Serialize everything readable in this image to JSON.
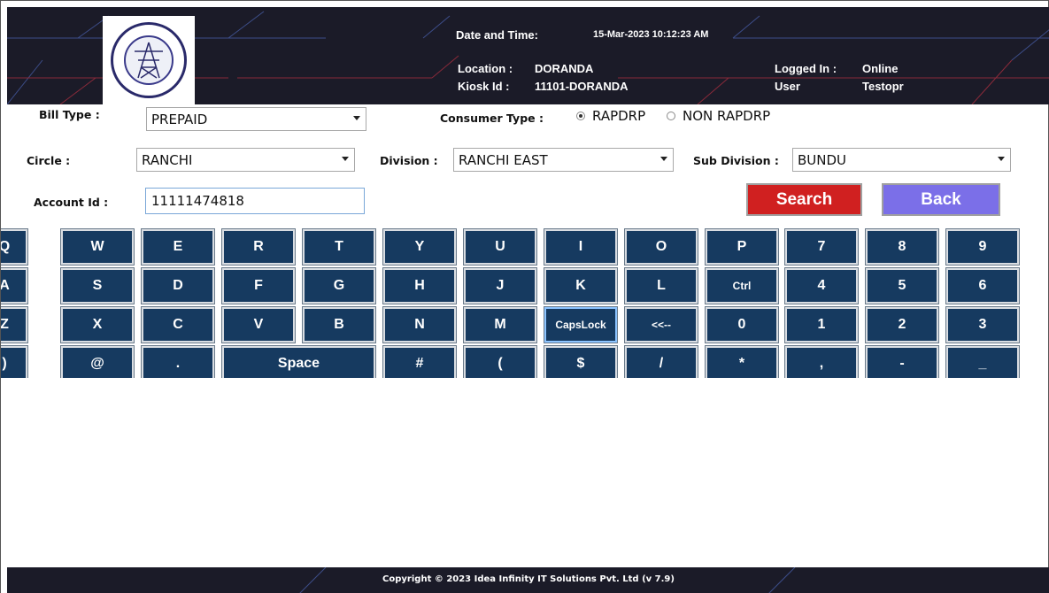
{
  "header": {
    "datetime_label": "Date and Time:",
    "datetime_value": "15-Mar-2023 10:12:23 AM",
    "location_label": "Location :",
    "location_value": "DORANDA",
    "kiosk_label": "Kiosk Id  :",
    "kiosk_value": "11101-DORANDA",
    "logged_in_label": "Logged In :",
    "logged_in_value": "Online",
    "user_label": "User",
    "user_value": "Testopr"
  },
  "form": {
    "bill_type_label": "Bill Type :",
    "bill_type_value": "PREPAID",
    "consumer_type_label": "Consumer Type :",
    "consumer_type_options": [
      "RAPDRP",
      "NON RAPDRP"
    ],
    "consumer_type_selected": "RAPDRP",
    "circle_label": "Circle :",
    "circle_value": "RANCHI",
    "division_label": "Division :",
    "division_value": "RANCHI EAST",
    "subdivision_label": "Sub Division :",
    "subdivision_value": "BUNDU",
    "account_label": "Account Id :",
    "account_value": "11111474818",
    "search_label": "Search",
    "back_label": "Back"
  },
  "keyboard": {
    "rows": [
      [
        "Q",
        "W",
        "E",
        "R",
        "T",
        "Y",
        "U",
        "I",
        "O",
        "P",
        "7",
        "8",
        "9"
      ],
      [
        "A",
        "S",
        "D",
        "F",
        "G",
        "H",
        "J",
        "K",
        "L",
        "Ctrl",
        "4",
        "5",
        "6"
      ],
      [
        "Z",
        "X",
        "C",
        "V",
        "B",
        "N",
        "M",
        "CapsLock",
        "<<--",
        "0",
        "1",
        "2",
        "3"
      ],
      [
        ")",
        "@",
        ".",
        "Space",
        "#",
        "(",
        "$",
        "/",
        "*",
        ",",
        "-",
        "_"
      ]
    ]
  },
  "footer": {
    "copyright": "Copyright © 2023 Idea Infinity IT Solutions Pvt. Ltd (v 7.9)"
  },
  "colors": {
    "header_bg": "#1b1b28",
    "key_bg": "#163a60",
    "search_bg": "#d02020",
    "back_bg": "#7b6fe8"
  }
}
